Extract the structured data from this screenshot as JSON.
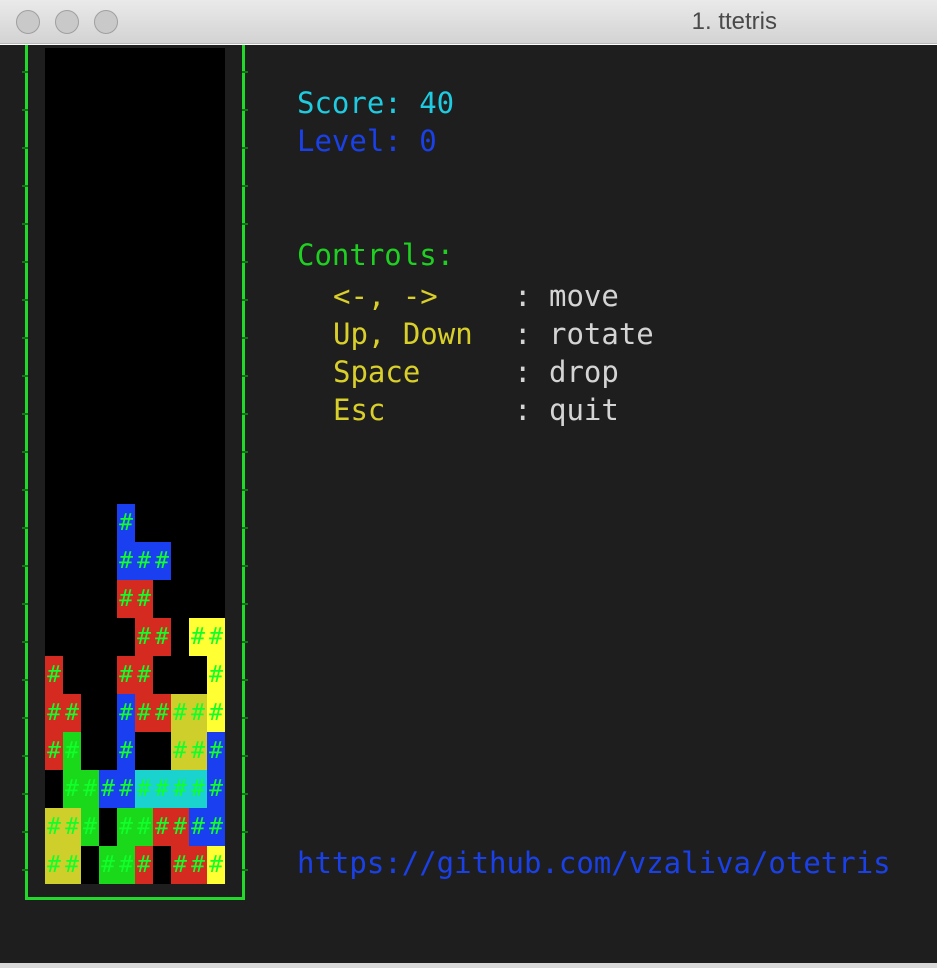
{
  "window": {
    "title": "1. ttetris"
  },
  "status": {
    "score_line": "Score: 40",
    "level_line": "Level: 0"
  },
  "controls": {
    "heading": "Controls:",
    "items": [
      {
        "key": "<-, ->",
        "sep": ":",
        "action": "move"
      },
      {
        "key": "Up, Down",
        "sep": ":",
        "action": "rotate"
      },
      {
        "key": "Space",
        "sep": ":",
        "action": "drop"
      },
      {
        "key": "Esc",
        "sep": ":",
        "action": "quit"
      }
    ]
  },
  "footer": {
    "url": "https://github.com/vzaliva/otetris"
  },
  "board": {
    "columns": 10,
    "rows": 22,
    "cell_glyph": "#",
    "colors": {
      "R": "#d42a1f",
      "B": "#1a3ff0",
      "G": "#1ad81a",
      "Y": "#ffff33",
      "O": "#cfcf2c",
      "C": "#1ad3cf"
    },
    "grid": [
      "..........",
      "..........",
      "..........",
      "..........",
      "..........",
      "..........",
      "..........",
      "..........",
      "..........",
      "..........",
      "..........",
      "..........",
      "..........",
      "....B.....",
      "....BBB...",
      "....RR....",
      ".....RR.YY",
      "R...RR...Y",
      "RR..BRROOY",
      "RG..B..OOB",
      ".GGBBCCCCB",
      "OOG.GGRRBB",
      "OO.GGR.RRY"
    ]
  }
}
